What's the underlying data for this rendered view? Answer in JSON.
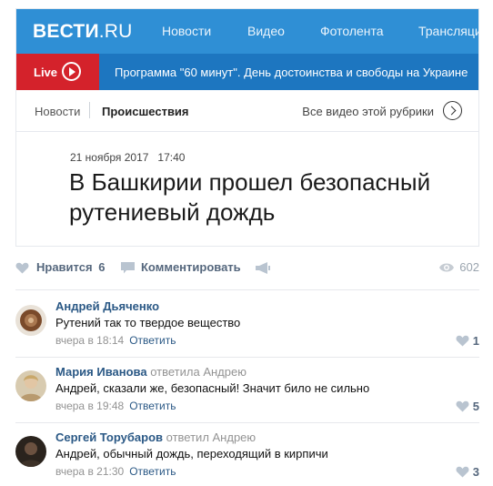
{
  "site": {
    "logo_main": "ВЕСТИ",
    "logo_suffix": ".RU",
    "nav": [
      "Новости",
      "Видео",
      "Фотолента",
      "Трансляци"
    ],
    "live_label": "Live",
    "live_program": "Программа \"60 минут\". День достоинства и свободы на Украине",
    "subnav": [
      "Новости",
      "Происшествия"
    ],
    "all_videos": "Все видео этой рубрики",
    "colors": {
      "header": "#2f8fd5",
      "live_bar": "#1d76c0",
      "live_badge": "#d4222b"
    }
  },
  "article": {
    "date": "21 ноября 2017",
    "time": "17:40",
    "title": "В Башкирии прошел безопасный рутениевый дождь"
  },
  "actions": {
    "like_label": "Нравится",
    "like_count": "6",
    "comment_label": "Комментировать",
    "views": "602"
  },
  "comments": [
    {
      "author": "Андрей Дьяченко",
      "replied": "",
      "text": "Рутений так то твердое вещество",
      "time": "вчера в 18:14",
      "reply_label": "Ответить",
      "likes": "1"
    },
    {
      "author": "Мария Иванова",
      "replied": "ответила Андрею",
      "text": "Андрей, сказали же, безопасный! Значит било не сильно",
      "time": "вчера в 19:48",
      "reply_label": "Ответить",
      "likes": "5"
    },
    {
      "author": "Сергей Торубаров",
      "replied": "ответил Андрею",
      "text": "Андрей, обычный дождь, переходящий в кирпичи",
      "time": "вчера в 21:30",
      "reply_label": "Ответить",
      "likes": "3"
    }
  ]
}
